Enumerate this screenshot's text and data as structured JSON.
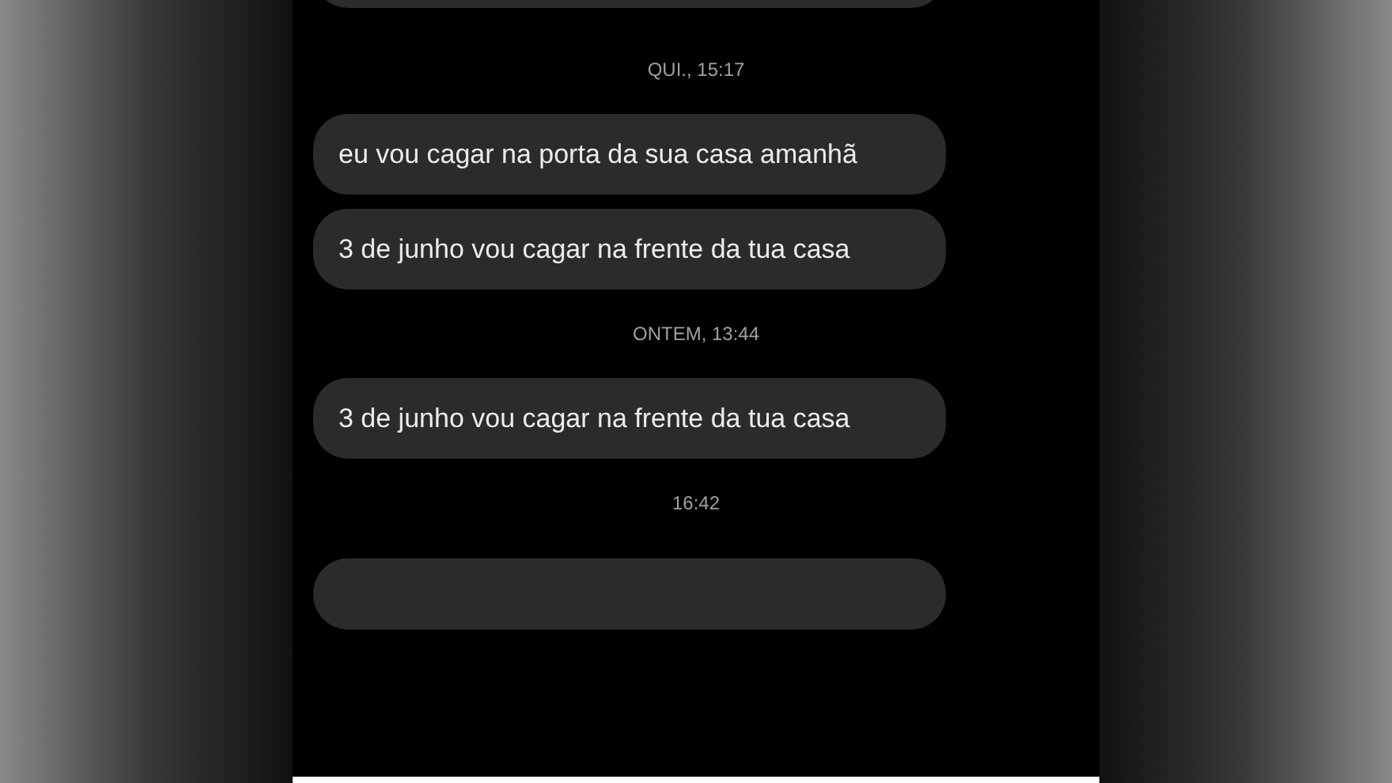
{
  "chat": [
    {
      "kind": "partial"
    },
    {
      "kind": "timestamp",
      "text": "QUI., 15:17"
    },
    {
      "kind": "message",
      "text": "eu vou cagar na porta da sua casa amanhã"
    },
    {
      "kind": "message",
      "text": "3 de junho vou cagar na frente da tua casa"
    },
    {
      "kind": "timestamp",
      "text": "ONTEM, 13:44"
    },
    {
      "kind": "message",
      "text": "3 de junho vou cagar na frente da tua casa"
    },
    {
      "kind": "timestamp",
      "text": "16:42"
    },
    {
      "kind": "partial"
    }
  ]
}
